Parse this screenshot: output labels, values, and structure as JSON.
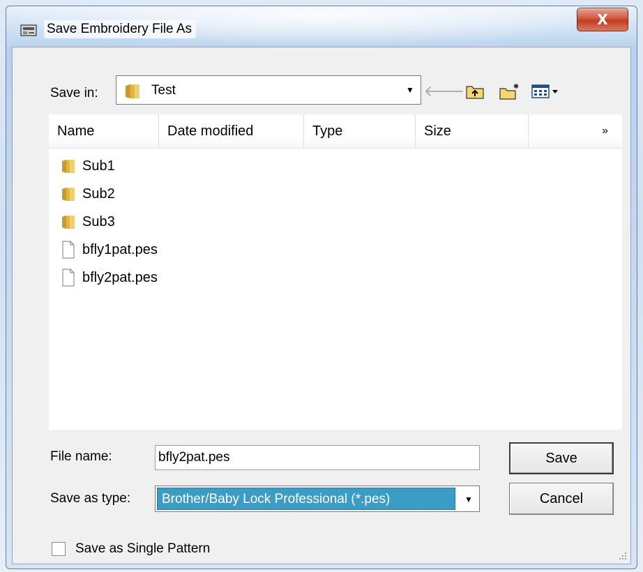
{
  "window": {
    "title": "Save Embroidery File As",
    "close_label": "X"
  },
  "toolbar": {
    "save_in_label": "Save in:",
    "save_in_value": "Test",
    "back_icon": "back-arrow-icon",
    "up_icon": "up-folder-icon",
    "new_folder_icon": "new-folder-icon",
    "view_icon": "view-menu-icon"
  },
  "file_list": {
    "columns": [
      "Name",
      "Date modified",
      "Type",
      "Size",
      "»"
    ],
    "items": [
      {
        "name": "Sub1",
        "kind": "folder"
      },
      {
        "name": "Sub2",
        "kind": "folder"
      },
      {
        "name": "Sub3",
        "kind": "folder"
      },
      {
        "name": "bfly1pat.pes",
        "kind": "file"
      },
      {
        "name": "bfly2pat.pes",
        "kind": "file"
      }
    ]
  },
  "form": {
    "file_name_label": "File name:",
    "file_name_value": "bfly2pat.pes",
    "save_type_label": "Save as type:",
    "save_type_value": "Brother/Baby Lock Professional (*.pes)",
    "single_pattern_label": "Save as Single Pattern"
  },
  "buttons": {
    "save": "Save",
    "cancel": "Cancel"
  },
  "colors": {
    "selection": "#3b9dc6",
    "close_button": "#c13b22",
    "folder": "#e8c34a"
  }
}
